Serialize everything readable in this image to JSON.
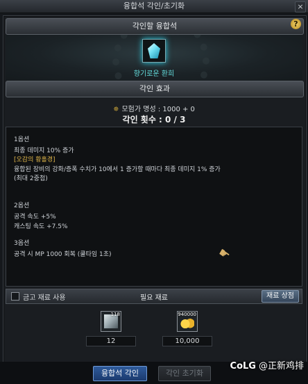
{
  "window": {
    "title": "융합석 각인/초기화",
    "close_label": "×"
  },
  "header": {
    "title": "각인할 융합석",
    "help_label": "?"
  },
  "item": {
    "name": "향기로운 환희"
  },
  "effect_bar": {
    "title": "각인 효과"
  },
  "stats": {
    "fame_text": "모험가 명성 : 1000 + 0",
    "engrave_count": "각인 횟수 : 0 / 3"
  },
  "options": [
    {
      "line": "1옵션"
    },
    {
      "line": "최종 데미지 10% 증가"
    },
    {
      "line": "[오감의 황홀경]"
    },
    {
      "line": "융합된 장비의 강화/증폭 수치가 10에서 1 증가할 때마다 최종 데미지 1% 증가"
    },
    {
      "line": "(최대 2중첩)"
    },
    {
      "line": "2옵션"
    },
    {
      "line": "공격 속도 +5%"
    },
    {
      "line": "캐스팅 속도 +7.5%"
    },
    {
      "line": "3옵션"
    },
    {
      "line": "공격 시 MP 1000 회복 (쿨타임 1초)"
    }
  ],
  "materials_bar": {
    "checkbox_label": "금고 재료 사용",
    "title": "필요 재료",
    "shop_button": "재료 상점"
  },
  "materials": [
    {
      "icon": "crystal-material-icon",
      "stack": "118",
      "required": "12"
    },
    {
      "icon": "gold-coins-icon",
      "stack": "940000",
      "required": "10,000"
    }
  ],
  "footer": {
    "engrave_button": "융합석 각인",
    "reset_button": "각인 초기화"
  },
  "watermark": {
    "brand": "CoLG",
    "user": "@正新鸡排"
  },
  "colors": {
    "accent_cyan": "#62d8d8",
    "highlight_gold": "#e0b64a",
    "primary_button": "#2e5a9a"
  }
}
